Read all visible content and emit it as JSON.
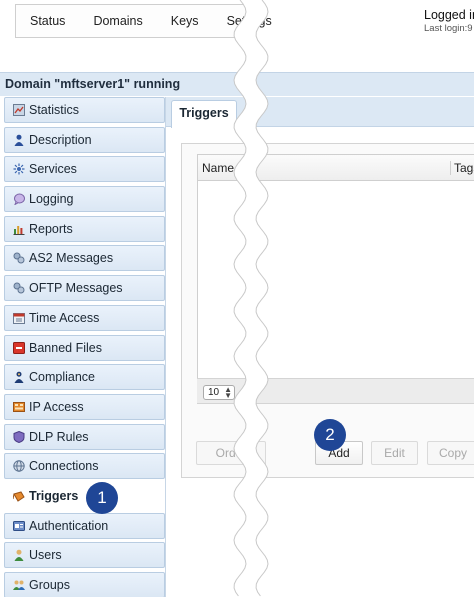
{
  "topnav": {
    "tabs": [
      "Status",
      "Domains",
      "Keys",
      "Settings"
    ]
  },
  "login": {
    "status": "Logged in",
    "last_login": "Last login:9"
  },
  "domain_header": {
    "title": "Domain \"mftserver1\" running"
  },
  "sidebar": {
    "items": [
      {
        "label": "Statistics",
        "icon": "statistics-icon"
      },
      {
        "label": "Description",
        "icon": "description-icon"
      },
      {
        "label": "Services",
        "icon": "services-icon"
      },
      {
        "label": "Logging",
        "icon": "logging-icon"
      },
      {
        "label": "Reports",
        "icon": "reports-icon"
      },
      {
        "label": "AS2 Messages",
        "icon": "as2-messages-icon"
      },
      {
        "label": "OFTP Messages",
        "icon": "oftp-messages-icon"
      },
      {
        "label": "Time Access",
        "icon": "time-access-icon"
      },
      {
        "label": "Banned Files",
        "icon": "banned-files-icon"
      },
      {
        "label": "Compliance",
        "icon": "compliance-icon"
      },
      {
        "label": "IP Access",
        "icon": "ip-access-icon"
      },
      {
        "label": "DLP Rules",
        "icon": "dlp-rules-icon"
      },
      {
        "label": "Connections",
        "icon": "connections-icon"
      },
      {
        "label": "Triggers",
        "icon": "triggers-icon",
        "active": true
      },
      {
        "label": "Authentication",
        "icon": "authentication-icon"
      },
      {
        "label": "Users",
        "icon": "users-icon"
      },
      {
        "label": "Groups",
        "icon": "groups-icon"
      }
    ]
  },
  "main": {
    "tab_label": "Triggers",
    "grid": {
      "columns": [
        "Name",
        "Tags"
      ],
      "rows": []
    },
    "pager": {
      "page_size": "10"
    },
    "buttons": {
      "order": "Order",
      "add": "Add",
      "edit": "Edit",
      "copy": "Copy"
    }
  },
  "callouts": {
    "one": "1",
    "two": "2"
  },
  "colors": {
    "header_blue": "#dce8f4",
    "callout_blue": "#1f4696",
    "border_blue": "#b9cde2"
  }
}
